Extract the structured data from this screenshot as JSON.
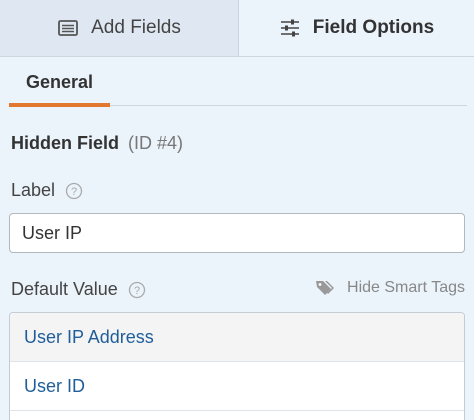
{
  "tabs": {
    "add_fields": {
      "label": "Add Fields",
      "icon": "list-icon"
    },
    "field_options": {
      "label": "Field Options",
      "icon": "sliders-icon"
    }
  },
  "subtabs": {
    "general": "General"
  },
  "field": {
    "name": "Hidden Field",
    "id_text": "(ID #4)"
  },
  "label_section": {
    "label": "Label",
    "value": "User IP"
  },
  "default_value": {
    "label": "Default Value",
    "smart_tags_toggle": "Hide Smart Tags"
  },
  "smart_tags": [
    {
      "label": "User IP Address"
    },
    {
      "label": "User ID"
    }
  ],
  "colors": {
    "accent": "#e27730",
    "link": "#1f5e9a",
    "panel_bg": "#ebf3fb"
  }
}
